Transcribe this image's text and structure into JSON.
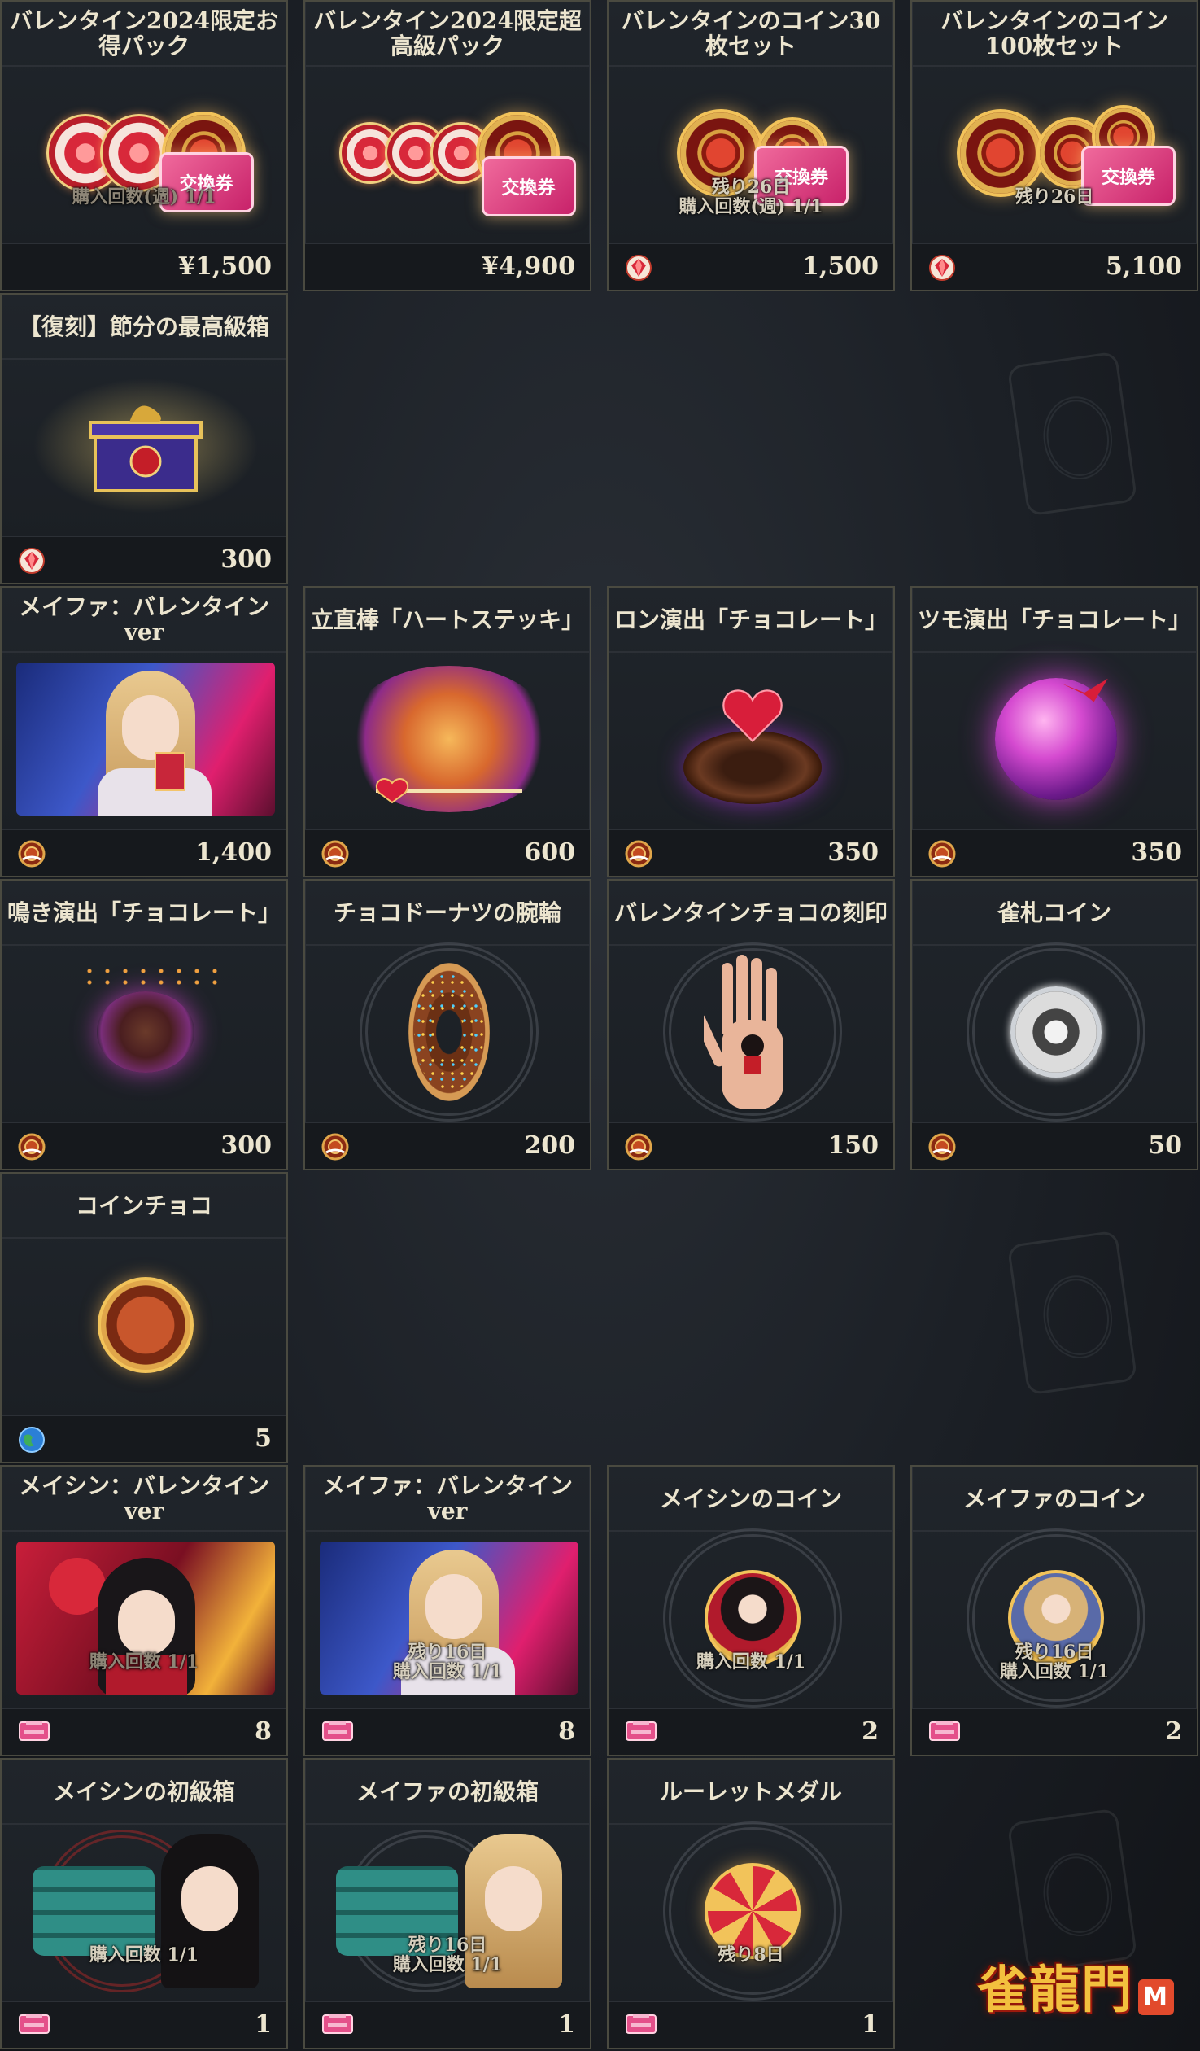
{
  "cards": [
    {
      "id": "c1",
      "title": "バレンタイン2024限定お得パック",
      "info": [
        "購入回数(週) 1/1"
      ],
      "info_faded": true,
      "currency": "yen",
      "price": "¥1,500"
    },
    {
      "id": "c2",
      "title": "バレンタイン2024限定超高級パック",
      "info": [],
      "currency": "yen",
      "price": "¥4,900"
    },
    {
      "id": "c3",
      "title": "バレンタインのコイン30枚セット",
      "info": [
        "残り26日",
        "購入回数(週) 1/1"
      ],
      "currency": "gem",
      "price": "1,500"
    },
    {
      "id": "c4",
      "title": "バレンタインのコイン100枚セット",
      "info": [
        "残り26日"
      ],
      "currency": "gem",
      "price": "5,100"
    },
    {
      "id": "c5",
      "title": "【復刻】節分の最高級箱",
      "info": [],
      "currency": "gem",
      "price": "300"
    },
    {
      "id": "c6",
      "title": "メイファ：バレンタインver",
      "info": [],
      "currency": "valentine-coin",
      "price": "1,400"
    },
    {
      "id": "c7",
      "title": "立直棒「ハートステッキ」",
      "info": [],
      "currency": "valentine-coin",
      "price": "600"
    },
    {
      "id": "c8",
      "title": "ロン演出「チョコレート」",
      "info": [],
      "currency": "valentine-coin",
      "price": "350"
    },
    {
      "id": "c9",
      "title": "ツモ演出「チョコレート」",
      "info": [],
      "currency": "valentine-coin",
      "price": "350"
    },
    {
      "id": "c10",
      "title": "鳴き演出「チョコレート」",
      "info": [],
      "currency": "valentine-coin",
      "price": "300"
    },
    {
      "id": "c11",
      "title": "チョコドーナツの腕輪",
      "info": [],
      "currency": "valentine-coin",
      "price": "200"
    },
    {
      "id": "c12",
      "title": "バレンタインチョコの刻印",
      "info": [],
      "currency": "valentine-coin",
      "price": "150"
    },
    {
      "id": "c13",
      "title": "雀札コイン",
      "info": [],
      "currency": "valentine-coin",
      "price": "50"
    },
    {
      "id": "c14",
      "title": "コインチョコ",
      "info": [],
      "currency": "globe",
      "price": "5"
    },
    {
      "id": "c15",
      "title": "メイシン：バレンタインver",
      "info": [
        "購入回数 1/1"
      ],
      "info_faded": true,
      "currency": "exchange-ticket",
      "price": "8"
    },
    {
      "id": "c16",
      "title": "メイファ：バレンタインver",
      "info": [
        "残り16日",
        "購入回数 1/1"
      ],
      "currency": "exchange-ticket",
      "price": "8"
    },
    {
      "id": "c17",
      "title": "メイシンのコイン",
      "info": [
        "購入回数 1/1"
      ],
      "currency": "exchange-ticket",
      "price": "2"
    },
    {
      "id": "c18",
      "title": "メイファのコイン",
      "info": [
        "残り16日",
        "購入回数 1/1"
      ],
      "currency": "exchange-ticket",
      "price": "2"
    },
    {
      "id": "c19",
      "title": "メイシンの初級箱",
      "info": [
        "購入回数 1/1"
      ],
      "currency": "exchange-ticket",
      "price": "1"
    },
    {
      "id": "c20",
      "title": "メイファの初級箱",
      "info": [
        "残り16日",
        "購入回数 1/1"
      ],
      "currency": "exchange-ticket",
      "price": "1"
    },
    {
      "id": "c21",
      "title": "ルーレットメダル",
      "info": [
        "残り8日"
      ],
      "currency": "exchange-ticket",
      "price": "1"
    }
  ],
  "art_labels": {
    "ticket": "交換券",
    "ticket_small": "交換券"
  },
  "logo": {
    "text": "雀龍門",
    "badge": "M"
  },
  "colors": {
    "card_border": "#4a4a40",
    "title_text": "#ece5cf",
    "info_text": "#d6cfbd",
    "accent_gold": "#f2c35a"
  }
}
